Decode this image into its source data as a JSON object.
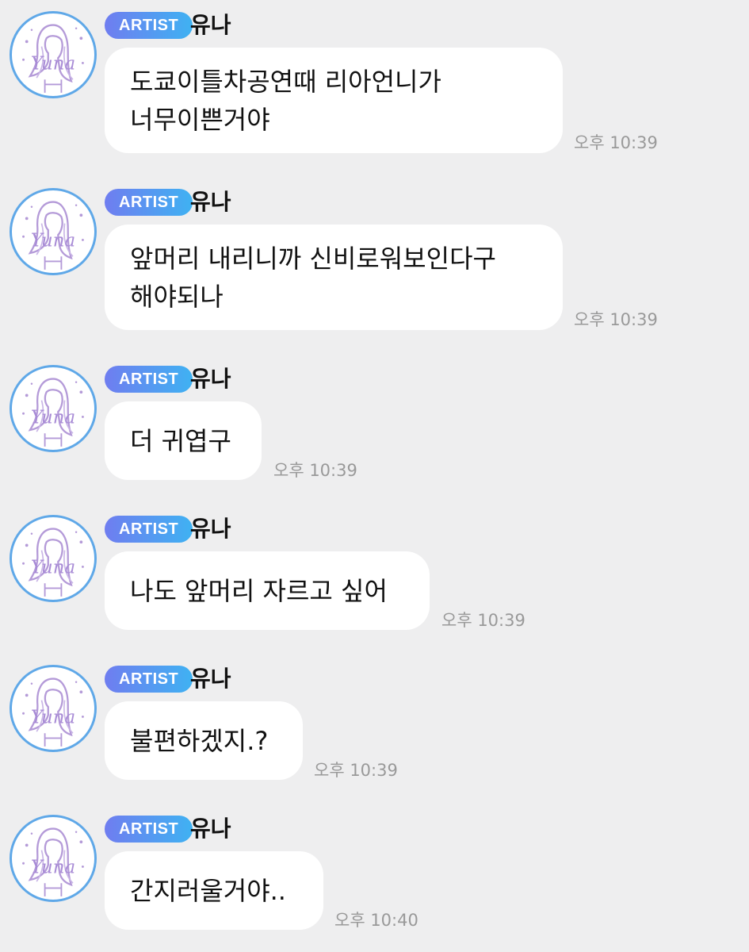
{
  "messages": [
    {
      "badge": "ARTIST",
      "sender": "유나",
      "avatar_icon": "yuna-avatar-icon",
      "text": "도쿄이틀차공연때 리아언니가\n너무이쁜거야",
      "time": "오후 10:39"
    },
    {
      "badge": "ARTIST",
      "sender": "유나",
      "avatar_icon": "yuna-avatar-icon",
      "text": "앞머리 내리니까 신비로워보인다구\n해야되나",
      "time": "오후 10:39"
    },
    {
      "badge": "ARTIST",
      "sender": "유나",
      "avatar_icon": "yuna-avatar-icon",
      "text": "더 귀엽구",
      "time": "오후 10:39"
    },
    {
      "badge": "ARTIST",
      "sender": "유나",
      "avatar_icon": "yuna-avatar-icon",
      "text": "나도 앞머리 자르고 싶어",
      "time": "오후 10:39"
    },
    {
      "badge": "ARTIST",
      "sender": "유나",
      "avatar_icon": "yuna-avatar-icon",
      "text": "불편하겠지.?",
      "time": "오후 10:39"
    },
    {
      "badge": "ARTIST",
      "sender": "유나",
      "avatar_icon": "yuna-avatar-icon",
      "text": "간지러울거야..",
      "time": "오후 10:40"
    }
  ],
  "colors": {
    "background": "#eeeeef",
    "bubble": "#ffffff",
    "badge_start": "#6f7df0",
    "badge_end": "#3fb2f2",
    "avatar_ring": "#5fa8e8",
    "avatar_art": "#b49ad8",
    "timestamp": "#999999"
  }
}
